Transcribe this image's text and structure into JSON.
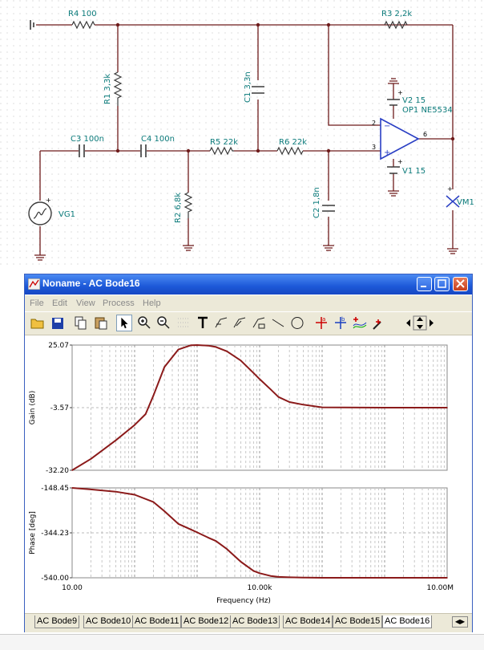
{
  "schematic": {
    "components": {
      "r4": "R4 100",
      "r3": "R3 2,2k",
      "r1": "R1 3,3k",
      "c1": "C1 3,3n",
      "c3": "C3 100n",
      "c4": "C4 100n",
      "r5": "R5 22k",
      "r6": "R6 22k",
      "r2": "R2 6,8k",
      "c2": "C2 1,8n",
      "v2": "V2 15",
      "v1": "V1 15",
      "op1": "OP1 NE5534",
      "vg1": "VG1",
      "vm1": "VM1",
      "pin2": "2",
      "pin3": "3",
      "pin6": "6"
    }
  },
  "window": {
    "title": "Noname - AC Bode16",
    "menu": [
      "File",
      "Edit",
      "View",
      "Process",
      "Help"
    ]
  },
  "chart_data": [
    {
      "type": "line",
      "title": "",
      "xlabel": "",
      "ylabel": "Gain (dB)",
      "xscale": "log",
      "xlim": [
        10,
        10000000
      ],
      "ylim": [
        -32.2,
        25.07
      ],
      "yticks": [
        "25.07",
        "-3.57",
        "-32.20"
      ],
      "grid": true,
      "series": [
        {
          "color": "#8b1a1a",
          "x": [
            10,
            20,
            50,
            100,
            150,
            200,
            300,
            500,
            800,
            1000,
            1500,
            2000,
            3000,
            5000,
            8000,
            10000,
            15000,
            20000,
            30000,
            50000,
            100000,
            1000000,
            10000000
          ],
          "y": [
            -32.2,
            -27,
            -18.5,
            -11.5,
            -6.5,
            2,
            15,
            23,
            25,
            25.07,
            24.8,
            24.2,
            22.2,
            18,
            12.3,
            9.5,
            4.8,
            1.3,
            -1,
            -2.2,
            -3.4,
            -3.57,
            -3.57
          ]
        }
      ]
    },
    {
      "type": "line",
      "title": "",
      "xlabel": "Frequency (Hz)",
      "ylabel": "Phase [deg]",
      "xscale": "log",
      "xlim": [
        10,
        10000000
      ],
      "ylim": [
        -540,
        -148.45
      ],
      "yticks": [
        "-148.45",
        "-344.23",
        "-540.00"
      ],
      "xticks": [
        "10.00",
        "10.00k",
        "10.00M"
      ],
      "grid": true,
      "series": [
        {
          "color": "#8b1a1a",
          "x": [
            10,
            20,
            50,
            100,
            200,
            300,
            500,
            800,
            1000,
            1500,
            2000,
            3000,
            5000,
            8000,
            10000,
            15000,
            20000,
            30000,
            50000,
            100000,
            1000000,
            10000000
          ],
          "y": [
            -148.45,
            -155,
            -165,
            -178,
            -210,
            -250,
            -305,
            -330,
            -342,
            -365,
            -380,
            -415,
            -470,
            -510,
            -520,
            -532,
            -536,
            -538,
            -539,
            -540,
            -540,
            -540
          ]
        }
      ]
    }
  ],
  "tabs": [
    "AC Bode9",
    "AC Bode10",
    "AC Bode11",
    "AC Bode12",
    "AC Bode13",
    "AC Bode14",
    "AC Bode15",
    "AC Bode16"
  ],
  "active_tab": "AC Bode16"
}
